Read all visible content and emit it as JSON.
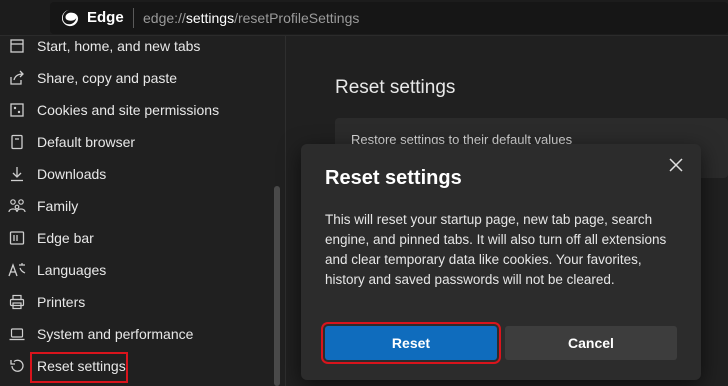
{
  "browser": {
    "name": "Edge",
    "url_prefix": "edge://",
    "url_strong": "settings",
    "url_rest": "/resetProfileSettings"
  },
  "sidebar": {
    "items": [
      {
        "label": "Start, home, and new tabs",
        "icon": "home-icon"
      },
      {
        "label": "Share, copy and paste",
        "icon": "share-icon"
      },
      {
        "label": "Cookies and site permissions",
        "icon": "cookies-icon"
      },
      {
        "label": "Default browser",
        "icon": "browser-icon"
      },
      {
        "label": "Downloads",
        "icon": "download-icon"
      },
      {
        "label": "Family",
        "icon": "family-icon"
      },
      {
        "label": "Edge bar",
        "icon": "edge-bar-icon"
      },
      {
        "label": "Languages",
        "icon": "languages-icon"
      },
      {
        "label": "Printers",
        "icon": "printer-icon"
      },
      {
        "label": "System and performance",
        "icon": "laptop-icon"
      },
      {
        "label": "Reset settings",
        "icon": "reset-icon",
        "active": true
      }
    ]
  },
  "main": {
    "title": "Reset settings",
    "card_text": "Restore settings to their default values"
  },
  "dialog": {
    "title": "Reset settings",
    "body": "This will reset your startup page, new tab page, search engine, and pinned tabs. It will also turn off all extensions and clear temporary data like cookies. Your favorites, history and saved passwords will not be cleared.",
    "reset_label": "Reset",
    "cancel_label": "Cancel"
  },
  "colors": {
    "accent": "#0f6cbd",
    "highlight": "#d9141c"
  }
}
